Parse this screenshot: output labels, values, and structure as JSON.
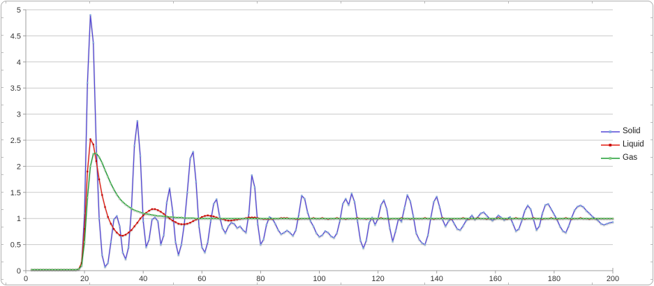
{
  "window": {
    "background_color": "#ffffff",
    "frame_border_color": "#aeaeae"
  },
  "chart_data": {
    "type": "line",
    "title": "",
    "xlabel": "",
    "ylabel": "",
    "xlim": [
      0,
      200
    ],
    "ylim": [
      0,
      5
    ],
    "x_ticks": [
      0,
      20,
      40,
      60,
      80,
      100,
      120,
      140,
      160,
      180,
      200
    ],
    "y_ticks": [
      0,
      0.5,
      1,
      1.5,
      2,
      2.5,
      3,
      3.5,
      4,
      4.5,
      5
    ],
    "y_tick_labels": [
      "0",
      "0.5",
      "1",
      "1.5",
      "2",
      "2.5",
      "3",
      "3.5",
      "4",
      "4.5",
      "5"
    ],
    "x_tick_labels": [
      "0",
      "20",
      "40",
      "60",
      "80",
      "100",
      "120",
      "140",
      "160",
      "180",
      "200"
    ],
    "grid": "horizontal",
    "legend_position": "right",
    "style": {
      "grid_color": "#c9c9c9",
      "axis_color": "#9c9c9c",
      "tick_label_color": "#333333"
    },
    "x_start": 2,
    "x_step": 1,
    "series": [
      {
        "name": "Solid",
        "color": "#5347d6",
        "marker_color": "#7fa8dc",
        "values": [
          0.02,
          0.02,
          0.02,
          0.02,
          0.02,
          0.02,
          0.02,
          0.02,
          0.02,
          0.02,
          0.02,
          0.02,
          0.02,
          0.02,
          0.02,
          0.02,
          0.03,
          0.1,
          1.1,
          3.6,
          4.9,
          4.37,
          2.4,
          1.0,
          0.3,
          0.07,
          0.15,
          0.55,
          0.98,
          1.05,
          0.85,
          0.35,
          0.22,
          0.45,
          1.2,
          2.4,
          2.87,
          2.2,
          0.95,
          0.45,
          0.6,
          0.98,
          1.02,
          0.95,
          0.5,
          0.68,
          1.3,
          1.58,
          1.15,
          0.55,
          0.3,
          0.5,
          0.9,
          1.5,
          2.15,
          2.28,
          1.7,
          0.85,
          0.45,
          0.35,
          0.55,
          0.95,
          1.28,
          1.37,
          1.05,
          0.82,
          0.72,
          0.85,
          0.92,
          0.9,
          0.82,
          0.85,
          0.78,
          0.73,
          1.1,
          1.83,
          1.6,
          0.9,
          0.5,
          0.6,
          0.88,
          1.03,
          1.0,
          0.9,
          0.78,
          0.7,
          0.73,
          0.77,
          0.73,
          0.67,
          0.78,
          1.08,
          1.44,
          1.38,
          1.12,
          0.95,
          0.85,
          0.72,
          0.65,
          0.68,
          0.76,
          0.73,
          0.66,
          0.63,
          0.72,
          0.95,
          1.28,
          1.38,
          1.26,
          1.48,
          1.32,
          0.95,
          0.58,
          0.43,
          0.58,
          0.92,
          1.02,
          0.88,
          1.0,
          1.26,
          1.35,
          1.18,
          0.82,
          0.56,
          0.76,
          1.0,
          0.94,
          1.2,
          1.45,
          1.33,
          1.05,
          0.72,
          0.6,
          0.53,
          0.5,
          0.68,
          1.02,
          1.32,
          1.42,
          1.22,
          0.98,
          0.85,
          0.95,
          1.0,
          0.9,
          0.8,
          0.78,
          0.86,
          0.96,
          1.0,
          1.06,
          0.98,
          1.03,
          1.1,
          1.12,
          1.06,
          1.0,
          0.96,
          1.0,
          1.06,
          1.02,
          0.97,
          1.0,
          1.03,
          0.9,
          0.76,
          0.8,
          0.96,
          1.15,
          1.25,
          1.18,
          0.98,
          0.78,
          0.86,
          1.1,
          1.26,
          1.28,
          1.18,
          1.08,
          0.98,
          0.85,
          0.76,
          0.73,
          0.86,
          1.02,
          1.16,
          1.23,
          1.25,
          1.22,
          1.15,
          1.1,
          1.04,
          1.0,
          0.96,
          0.9,
          0.88,
          0.9,
          0.92,
          0.93
        ]
      },
      {
        "name": "Liquid",
        "color": "#e41a0e",
        "marker_color": "#c40000",
        "values": [
          0.02,
          0.02,
          0.02,
          0.02,
          0.02,
          0.02,
          0.02,
          0.02,
          0.02,
          0.02,
          0.02,
          0.02,
          0.02,
          0.02,
          0.02,
          0.02,
          0.03,
          0.15,
          0.8,
          1.9,
          2.52,
          2.42,
          2.1,
          1.75,
          1.45,
          1.22,
          1.03,
          0.9,
          0.8,
          0.73,
          0.68,
          0.67,
          0.69,
          0.73,
          0.78,
          0.85,
          0.92,
          1.0,
          1.06,
          1.11,
          1.15,
          1.18,
          1.18,
          1.16,
          1.13,
          1.09,
          1.04,
          1.0,
          0.96,
          0.93,
          0.9,
          0.89,
          0.89,
          0.9,
          0.92,
          0.95,
          0.98,
          1.0,
          1.03,
          1.05,
          1.06,
          1.05,
          1.04,
          1.02,
          1.0,
          0.99,
          0.97,
          0.96,
          0.96,
          0.97,
          0.98,
          0.99,
          1.0,
          1.01,
          1.02,
          1.02,
          1.02,
          1.01,
          1.0,
          0.99,
          0.99,
          0.99,
          0.99,
          1.0,
          1.0,
          1.01,
          1.01,
          1.01,
          1.0,
          1.0,
          0.99,
          0.99,
          1.0,
          1.0,
          1.0,
          1.0,
          1.01,
          1.0,
          1.0,
          1.01,
          1.0,
          0.99,
          1.0,
          1.0,
          1.01,
          1.0,
          1.0,
          0.99,
          1.0,
          1.0,
          1.0,
          1.01,
          1.0,
          1.0,
          0.99,
          1.0,
          1.0,
          1.0,
          1.0,
          1.01,
          1.0,
          1.0,
          0.99,
          1.0,
          1.0,
          1.0,
          1.01,
          1.0,
          1.0,
          0.99,
          1.0,
          1.0,
          1.0,
          1.0,
          1.01,
          1.0,
          1.0,
          0.99,
          1.0,
          1.0,
          1.01,
          1.0,
          1.0,
          0.99,
          1.0,
          1.0,
          1.0,
          1.01,
          1.0,
          0.99,
          1.0,
          1.0,
          1.01,
          1.0,
          1.0,
          0.99,
          1.0,
          1.0,
          1.0,
          1.01,
          1.0,
          1.0,
          0.99,
          1.0,
          1.0,
          1.01,
          1.0,
          1.0,
          0.99,
          1.0,
          1.0,
          1.01,
          1.0,
          1.0,
          0.99,
          1.0,
          1.0,
          1.01,
          1.0,
          0.99,
          1.0,
          1.0,
          1.01,
          1.0,
          0.99,
          1.0,
          1.0,
          1.01,
          1.0,
          1.0,
          0.99,
          1.0,
          1.0,
          1.0,
          1.0,
          1.0,
          1.0,
          1.0,
          1.0
        ]
      },
      {
        "name": "Gas",
        "color": "#1c9c32",
        "marker_color": "#7dc87d",
        "values": [
          0.02,
          0.02,
          0.02,
          0.02,
          0.02,
          0.02,
          0.02,
          0.02,
          0.02,
          0.02,
          0.02,
          0.02,
          0.02,
          0.02,
          0.02,
          0.02,
          0.03,
          0.1,
          0.55,
          1.4,
          2.0,
          2.24,
          2.25,
          2.18,
          2.07,
          1.93,
          1.8,
          1.67,
          1.56,
          1.46,
          1.38,
          1.32,
          1.27,
          1.23,
          1.19,
          1.16,
          1.14,
          1.12,
          1.1,
          1.09,
          1.08,
          1.07,
          1.06,
          1.05,
          1.05,
          1.04,
          1.04,
          1.03,
          1.03,
          1.02,
          1.02,
          1.02,
          1.01,
          1.01,
          1.01,
          1.01,
          1.0,
          1.0,
          1.0,
          1.0,
          1.0,
          1.0,
          1.0,
          1.0,
          1.0,
          1.0,
          1.0,
          1.0,
          1.0,
          1.0,
          1.0,
          1.0,
          1.0,
          1.0,
          1.0,
          1.0,
          1.0,
          1.0,
          1.0,
          1.0,
          1.0,
          1.0,
          1.0,
          1.0,
          1.0,
          1.0,
          1.0,
          1.0,
          1.0,
          1.0,
          1.0,
          1.0,
          1.0,
          1.0,
          1.0,
          1.0,
          1.0,
          1.0,
          1.0,
          1.0,
          1.0,
          1.0,
          1.0,
          1.0,
          1.0,
          1.0,
          1.0,
          1.0,
          1.0,
          1.0,
          1.0,
          1.0,
          1.0,
          1.0,
          1.0,
          1.0,
          1.0,
          1.0,
          1.0,
          1.0,
          1.0,
          1.0,
          1.0,
          1.0,
          1.0,
          1.0,
          1.0,
          1.0,
          1.0,
          1.0,
          1.0,
          1.0,
          1.0,
          1.0,
          1.0,
          1.0,
          1.0,
          1.0,
          1.0,
          1.0,
          1.0,
          1.0,
          1.0,
          1.0,
          1.0,
          1.0,
          1.0,
          1.0,
          1.0,
          1.0,
          1.0,
          1.0,
          1.0,
          1.0,
          1.0,
          1.0,
          1.0,
          1.0,
          1.0,
          1.0,
          1.0,
          1.0,
          1.0,
          1.0,
          1.0,
          1.0,
          1.0,
          1.0,
          1.0,
          1.0,
          1.0,
          1.0,
          1.0,
          1.0,
          1.0,
          1.0,
          1.0,
          1.0,
          1.0,
          1.0,
          1.0,
          1.0,
          1.0,
          1.0,
          1.0,
          1.0,
          1.0,
          1.0,
          1.0,
          1.0,
          1.0,
          1.0,
          1.0,
          1.0,
          1.0,
          1.0,
          1.0,
          1.0,
          1.0
        ]
      }
    ]
  },
  "legend": {
    "items": [
      {
        "label": "Solid"
      },
      {
        "label": "Liquid"
      },
      {
        "label": "Gas"
      }
    ]
  }
}
